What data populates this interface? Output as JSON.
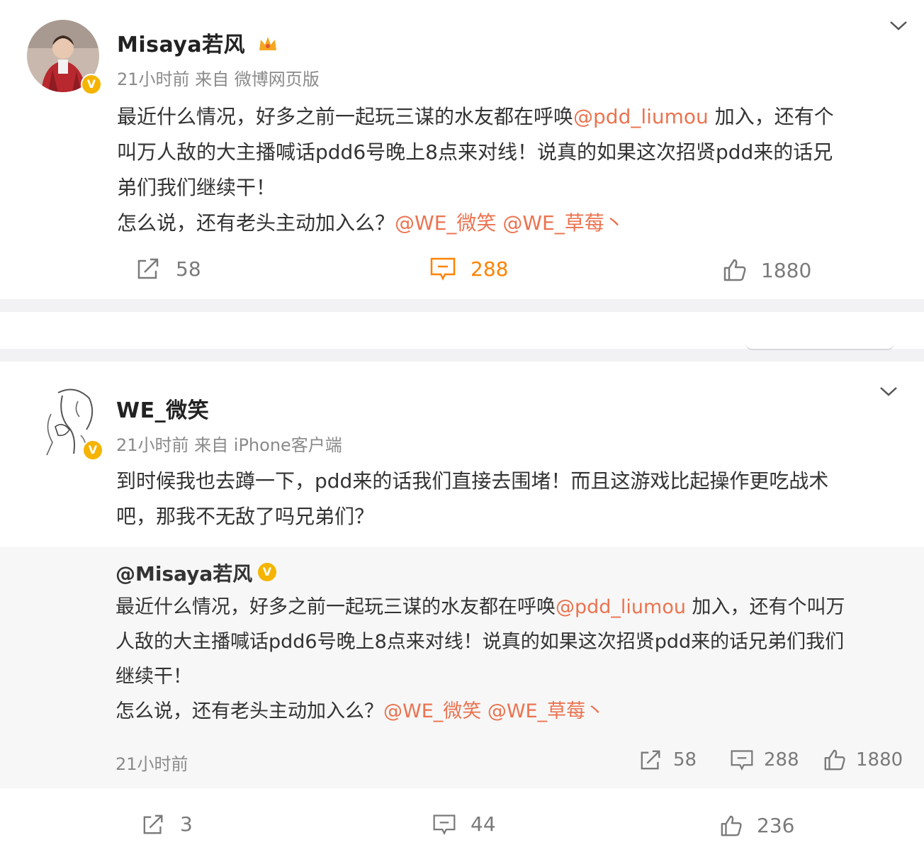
{
  "post1": {
    "author": "Misaya若风",
    "meta": "21小时前  来自 微博网页版",
    "lines": [
      [
        {
          "t": "最近什么情况，好多之前一起玩三谋的水友都在呼唤"
        },
        {
          "t": "@pdd_liumou",
          "m": true
        },
        {
          "t": " 加入，还有个"
        }
      ],
      [
        {
          "t": "叫万人敌的大主播喊话pdd6号晚上8点来对线！说真的如果这次招贤pdd来的话兄"
        }
      ],
      [
        {
          "t": "弟们我们继续干！"
        }
      ],
      [
        {
          "t": "怎么说，还有老头主动加入么？"
        },
        {
          "t": "@WE_微笑",
          "m": true
        },
        {
          "t": "  "
        },
        {
          "t": "@WE_草莓丶",
          "m": true
        }
      ]
    ],
    "repost_count": "58",
    "comment_count": "288",
    "like_count": "1880"
  },
  "post2": {
    "author": "WE_微笑",
    "meta": "21小时前  来自 iPhone客户端",
    "lines": [
      [
        {
          "t": "到时候我也去蹲一下，pdd来的话我们直接去围堵！而且这游戏比起操作更吃战术"
        }
      ],
      [
        {
          "t": "吧，那我不无敌了吗兄弟们？"
        }
      ]
    ],
    "repost": {
      "author": "@Misaya若风",
      "lines": [
        [
          {
            "t": "最近什么情况，好多之前一起玩三谋的水友都在呼唤"
          },
          {
            "t": "@pdd_liumou",
            "m": true
          },
          {
            "t": " 加入，还有个叫万"
          }
        ],
        [
          {
            "t": "人敌的大主播喊话pdd6号晚上8点来对线！说真的如果这次招贤pdd来的话兄弟们我们"
          }
        ],
        [
          {
            "t": "继续干！"
          }
        ],
        [
          {
            "t": "怎么说，还有老头主动加入么？"
          },
          {
            "t": "@WE_微笑",
            "m": true
          },
          {
            "t": "  "
          },
          {
            "t": "@WE_草莓丶",
            "m": true
          }
        ]
      ],
      "time": "21小时前",
      "repost_count": "58",
      "comment_count": "288",
      "like_count": "1880"
    },
    "repost_count": "3",
    "comment_count": "44",
    "like_count": "236"
  },
  "colors": {
    "mention": "#eb7350",
    "active": "#ff8200",
    "verified": "#f5b400"
  },
  "icons": {
    "repost": "share-icon",
    "comment": "comment-icon",
    "like": "thumbs-up-icon",
    "menu": "chevron-down-icon",
    "verified": "verified-badge-icon"
  }
}
